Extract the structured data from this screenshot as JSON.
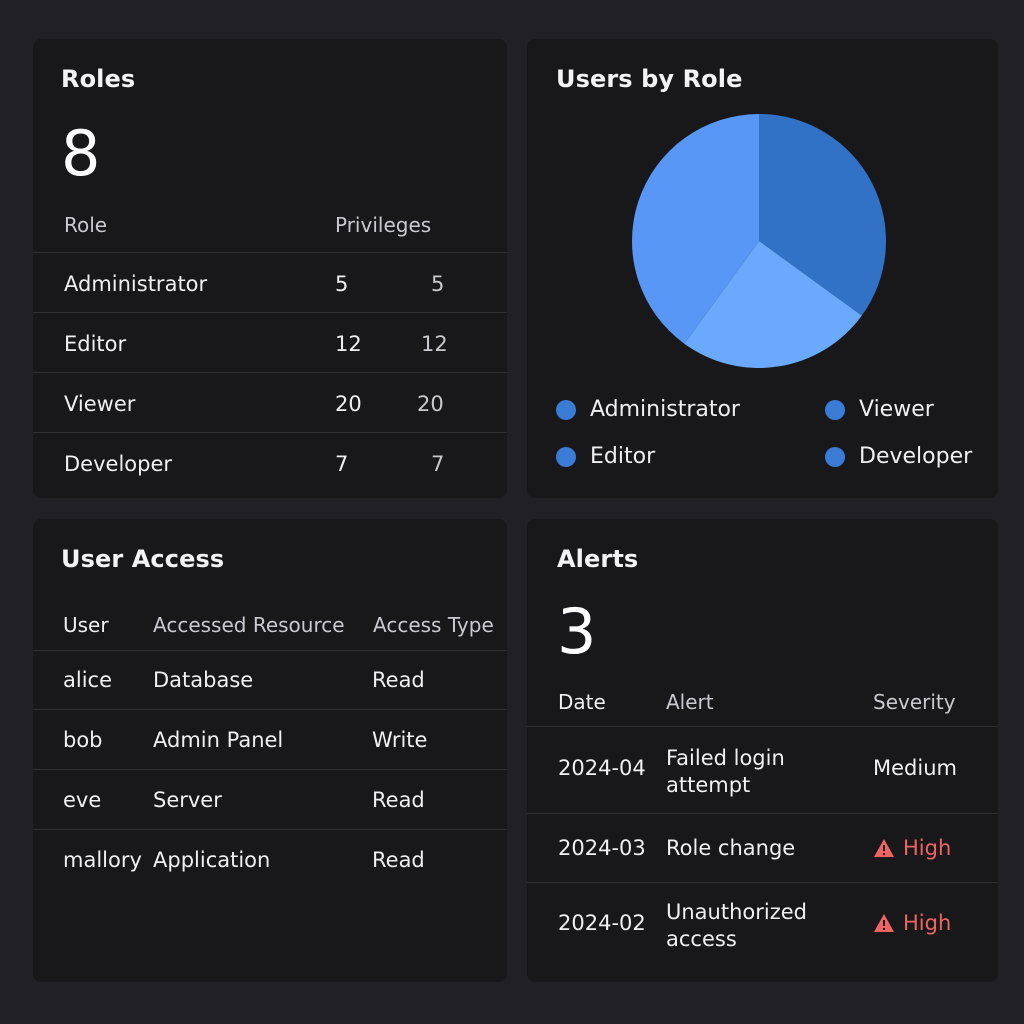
{
  "roles": {
    "title": "Roles",
    "count": "8",
    "headers": {
      "role": "Role",
      "privileges": "Privileges"
    },
    "rows": [
      {
        "role": "Administrator",
        "privileges": "5",
        "extra": "5"
      },
      {
        "role": "Editor",
        "privileges": "12",
        "extra": "12"
      },
      {
        "role": "Viewer",
        "privileges": "20",
        "extra": "20"
      },
      {
        "role": "Developer",
        "privileges": "7",
        "extra": "7"
      }
    ]
  },
  "users_by_role": {
    "title": "Users by Role",
    "legend": [
      {
        "label": "Administrator",
        "color": "#3a7bd5"
      },
      {
        "label": "Viewer",
        "color": "#3a7bd5"
      },
      {
        "label": "Editor",
        "color": "#3a7bd5"
      },
      {
        "label": "Developer",
        "color": "#3a7bd5"
      }
    ]
  },
  "chart_data": {
    "type": "pie",
    "title": "Users by Role",
    "slices": [
      {
        "value": 35,
        "color": "#3172c6"
      },
      {
        "value": 25,
        "color": "#6aa9fb"
      },
      {
        "value": 40,
        "color": "#5897f5"
      }
    ],
    "start_angle_deg": 0
  },
  "user_access": {
    "title": "User Access",
    "headers": {
      "user": "User",
      "resource": "Accessed Resource",
      "type": "Access Type"
    },
    "rows": [
      {
        "user": "alice",
        "resource": "Database",
        "type": "Read"
      },
      {
        "user": "bob",
        "resource": "Admin Panel",
        "type": "Write"
      },
      {
        "user": "eve",
        "resource": "Server",
        "type": "Read"
      },
      {
        "user": "mallory",
        "resource": "Application",
        "type": "Read"
      }
    ]
  },
  "alerts": {
    "title": "Alerts",
    "count": "3",
    "headers": {
      "date": "Date",
      "alert": "Alert",
      "severity": "Severity"
    },
    "rows": [
      {
        "date": "2024-04",
        "alert": "Failed login attempt",
        "severity": "Medium",
        "icon": ""
      },
      {
        "date": "2024-03",
        "alert": "Role change",
        "severity": "High",
        "icon": "warning-icon"
      },
      {
        "date": "2024-02",
        "alert": "Unauthorized access",
        "severity": "High",
        "icon": "warning-icon"
      }
    ],
    "colors": {
      "high": "#f06363"
    }
  }
}
